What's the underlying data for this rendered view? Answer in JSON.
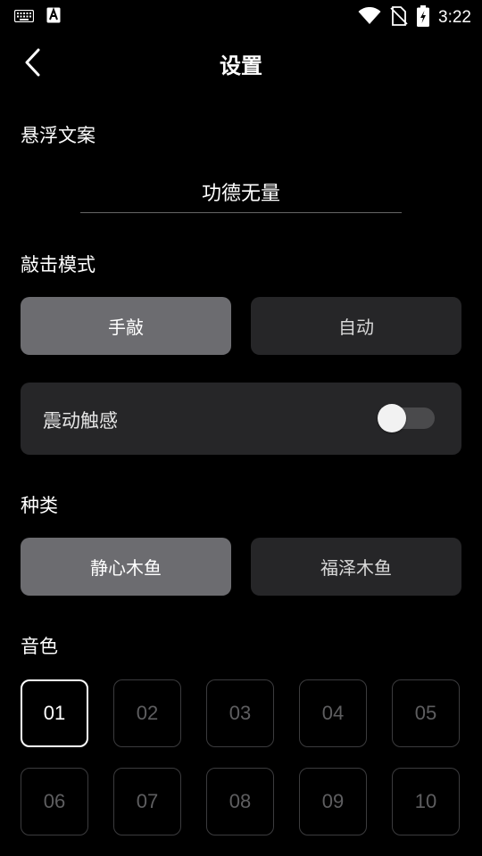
{
  "status_bar": {
    "time": "3:22",
    "icons": [
      "keyboard-icon",
      "a-notification-icon",
      "wifi-icon",
      "no-sim-icon",
      "battery-charging-icon"
    ]
  },
  "header": {
    "title": "设置",
    "back_icon": "chevron-left-icon"
  },
  "float_text": {
    "label": "悬浮文案",
    "value": "功德无量"
  },
  "tap_mode": {
    "label": "敲击模式",
    "options": [
      "手敲",
      "自动"
    ],
    "selected": 0
  },
  "vibration": {
    "label": "震动触感",
    "enabled": false
  },
  "category": {
    "label": "种类",
    "options": [
      "静心木鱼",
      "福泽木鱼"
    ],
    "selected": 0
  },
  "tone": {
    "label": "音色",
    "options": [
      "01",
      "02",
      "03",
      "04",
      "05",
      "06",
      "07",
      "08",
      "09",
      "10"
    ],
    "selected": "01"
  },
  "colors": {
    "background": "#000000",
    "selected_button": "#6c6c70",
    "unselected_button": "#262628",
    "tone_border": "#3c3c3e",
    "tone_text": "#5e5e60"
  }
}
